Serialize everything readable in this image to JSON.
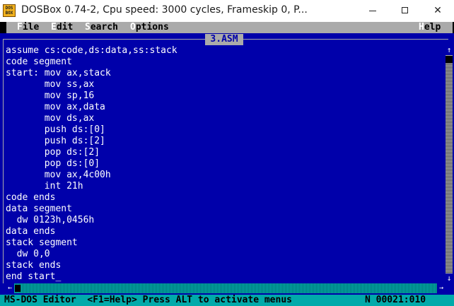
{
  "window": {
    "title": "DOSBox 0.74-2, Cpu speed:     3000 cycles, Frameskip  0, P...",
    "icon_text": [
      "DOS",
      "BOX"
    ],
    "minimize_icon": "minimize-icon",
    "maximize_icon": "maximize-icon",
    "close_icon": "close-icon",
    "close_glyph": "✕"
  },
  "menu": {
    "file": {
      "hot": "F",
      "rest": "ile"
    },
    "edit": {
      "hot": "E",
      "rest": "dit"
    },
    "search": {
      "hot": "S",
      "rest": "earch"
    },
    "options": {
      "hot": "O",
      "rest": "ptions"
    },
    "help": {
      "hot": "H",
      "rest": "elp"
    }
  },
  "editor": {
    "filename": "3.ASM",
    "code": "assume cs:code,ds:data,ss:stack\ncode segment\nstart: mov ax,stack\n       mov ss,ax\n       mov sp,16\n       mov ax,data\n       mov ds,ax\n       push ds:[0]\n       push ds:[2]\n       pop ds:[2]\n       pop ds:[0]\n       mov ax,4c00h\n       int 21h\ncode ends\ndata segment\n  dw 0123h,0456h\ndata ends\nstack segment\n  dw 0,0\nstack ends\nend start_"
  },
  "scrollbars": {
    "up_arrow": "↑",
    "down_arrow": "↓",
    "left_arrow": "←",
    "right_arrow": "→"
  },
  "status": {
    "left": "MS-DOS Editor  <F1=Help> Press ALT to activate menus",
    "right": "N 00021:010"
  },
  "colors": {
    "dos_blue": "#0000aa",
    "menu_gray": "#aaaaaa",
    "status_cyan": "#00aaaa"
  }
}
